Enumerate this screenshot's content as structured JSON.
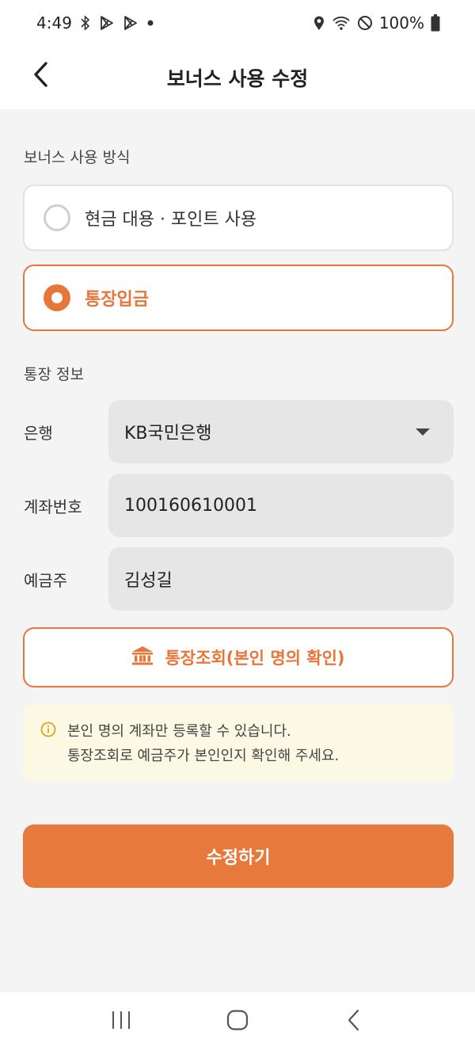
{
  "status_bar": {
    "time": "4:49",
    "battery": "100%",
    "icons_left": [
      "bluetooth-icon",
      "play-store-icon",
      "play-store-icon",
      "dot-icon"
    ],
    "icons_right": [
      "location-icon",
      "wifi-icon",
      "do-not-disturb-icon",
      "battery-icon"
    ]
  },
  "header": {
    "title": "보너스 사용 수정",
    "back_icon": "chevron-left-icon"
  },
  "usage": {
    "section_label": "보너스 사용 방식",
    "options": [
      {
        "label": "현금 대용 · 포인트 사용",
        "selected": false
      },
      {
        "label": "통장입금",
        "selected": true
      }
    ]
  },
  "account": {
    "section_label": "통장 정보",
    "bank_label": "은행",
    "bank_value": "KB국민은행",
    "number_label": "계좌번호",
    "number_value": "100160610001",
    "holder_label": "예금주",
    "holder_value": "김성길"
  },
  "verify_button": {
    "label": "통장조회(본인 명의 확인)",
    "icon": "bank-icon"
  },
  "notice": {
    "icon": "info-icon",
    "line1": "본인 명의 계좌만 등록할 수 있습니다.",
    "line2": "통장조회로 예금주가 본인인지 확인해 주세요."
  },
  "submit": {
    "label": "수정하기"
  },
  "colors": {
    "accent": "#e8763a",
    "field_bg": "#e6e6e6",
    "notice_bg": "#fbf9e4",
    "page_bg": "#f4f4f4"
  },
  "nav_bar": {
    "buttons": [
      "recent-apps-icon",
      "home-icon",
      "back-icon"
    ]
  }
}
